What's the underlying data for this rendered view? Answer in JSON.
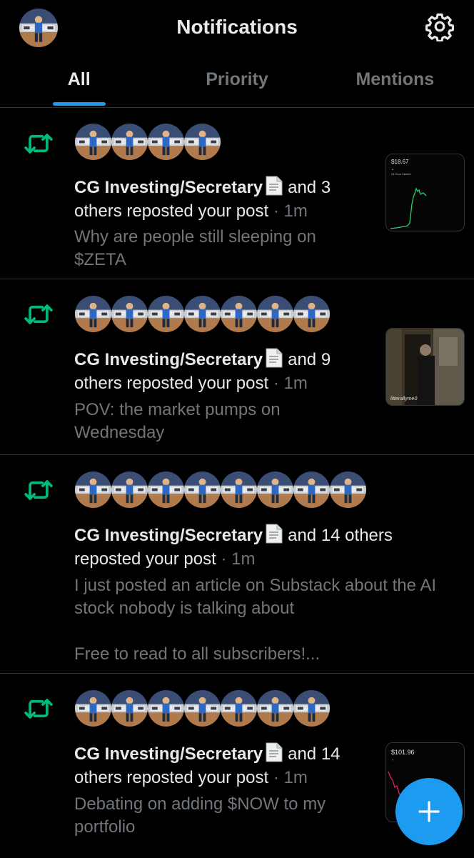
{
  "header": {
    "title": "Notifications",
    "tabs": [
      {
        "label": "All",
        "active": true
      },
      {
        "label": "Priority",
        "active": false
      },
      {
        "label": "Mentions",
        "active": false
      }
    ]
  },
  "colors": {
    "accent": "#1d9bf0",
    "repost_green": "#00ba7c",
    "muted_text": "#71767b",
    "background": "#000000"
  },
  "notifications": [
    {
      "icon": "repost-icon",
      "avatar_count": 4,
      "actor": "CG Investing/Secretary",
      "action_first": "and 3",
      "action_second": "others reposted your post",
      "time": "· 1m",
      "preview_line1": "Why are people still sleeping on",
      "preview_line2": "$ZETA",
      "thumbnail": {
        "price": "$18.67",
        "caption": "24 Hour Market"
      }
    },
    {
      "icon": "repost-icon",
      "avatar_count": 7,
      "actor": "CG Investing/Secretary",
      "action_first": "and 9",
      "action_second": "others reposted your post",
      "time": "· 1m",
      "preview_line1": "POV: the market pumps on",
      "preview_line2": "Wednesday",
      "thumbnail": {
        "watermark": "litterallyme0"
      }
    },
    {
      "icon": "repost-icon",
      "avatar_count": 8,
      "actor": "CG Investing/Secretary",
      "action_first": "and 14 others",
      "action_second": "reposted your post",
      "time": "· 1m",
      "preview_line1": "I just posted an article on Substack about the AI",
      "preview_line2": "stock nobody is talking about",
      "preview_line3": "Free to read to all subscribers!..."
    },
    {
      "icon": "repost-icon",
      "avatar_count": 7,
      "actor": "CG Investing/Secretary",
      "action_first": "and 14",
      "action_second": "others reposted your post",
      "time": "· 1m",
      "preview_line1": "Debating on adding $NOW to my",
      "preview_line2": "portfolio",
      "thumbnail": {
        "price": "$101.96"
      }
    }
  ],
  "fab": {
    "icon": "plus-icon"
  }
}
